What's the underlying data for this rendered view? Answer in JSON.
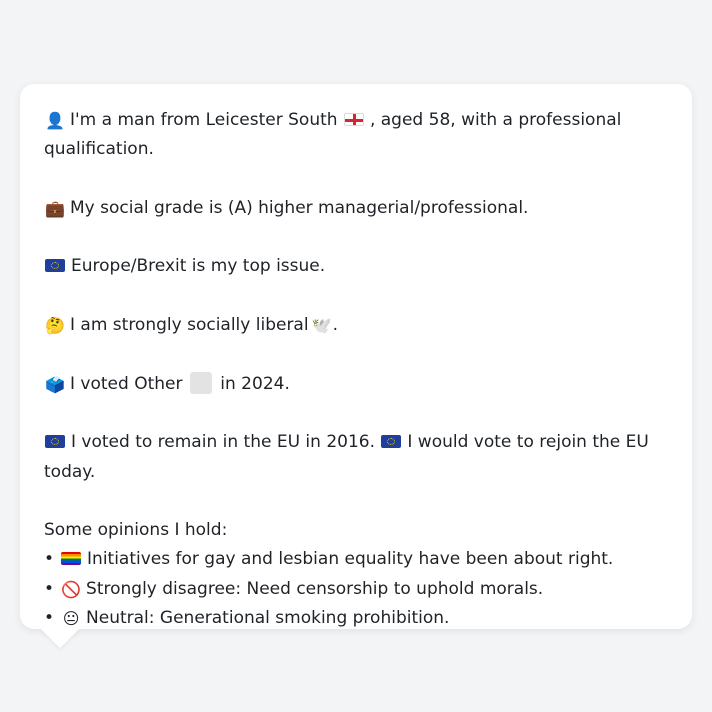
{
  "persona": {
    "line1": {
      "icon": "bust-in-silhouette-icon",
      "icon_glyph": "👤",
      "text_a": "I'm a man from Leicester South",
      "flag": "england-flag-icon",
      "text_b": ", aged 58, with a professional qualification."
    },
    "line2": {
      "icon": "briefcase-icon",
      "icon_glyph": "💼",
      "text": "My social grade is (A) higher managerial/professional."
    },
    "line3": {
      "icon": "eu-flag-icon",
      "text": "Europe/Brexit is my top issue."
    },
    "line4": {
      "icon": "thinking-face-icon",
      "icon_glyph": "🤔",
      "text": "I am strongly socially liberal",
      "trailing_icon": "dove-icon",
      "trailing_glyph": "🕊️",
      "trailing_text": "."
    },
    "line5": {
      "icon": "ballot-box-icon",
      "icon_glyph": "🗳️",
      "text_a": "I voted Other",
      "placeholder": "grey-square-icon",
      "text_b": "in 2024."
    },
    "line6": {
      "icon": "eu-flag-icon",
      "text_a": "I voted to remain in the EU in 2016.",
      "icon2": "eu-flag-icon",
      "text_b": "I would vote to rejoin the EU today."
    }
  },
  "opinions": {
    "heading": "Some opinions I hold:",
    "bullet": "•",
    "items": [
      {
        "icon": "rainbow-flag-icon",
        "text": "Initiatives for gay and lesbian equality have been about right."
      },
      {
        "icon": "prohibited-icon",
        "icon_glyph": "🚫",
        "text": "Strongly disagree: Need censorship to uphold morals."
      },
      {
        "icon": "neutral-face-icon",
        "icon_glyph": "😐",
        "text": "Neutral: Generational smoking prohibition."
      }
    ]
  },
  "colors": {
    "background": "#f3f4f6",
    "card": "#ffffff",
    "text": "#1f2328",
    "eu_blue": "#1f3f9a",
    "eu_gold": "#f5c400",
    "england_red": "#d22730"
  }
}
